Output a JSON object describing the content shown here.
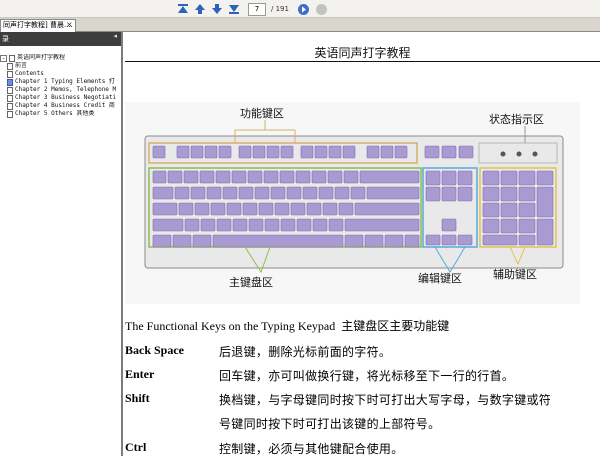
{
  "toolbar": {
    "page_current": "7",
    "page_total": "/ 191",
    "colors": {
      "nav_blue": "#2d63b8",
      "go_blue": "#3a6fd0",
      "disabled_grey": "#c2c2c2"
    }
  },
  "tab": {
    "label": "同声打字教程] 曹晨....",
    "close": "×"
  },
  "sidebar": {
    "header": "录",
    "collapse": "◂",
    "tree": [
      {
        "label": "英语同声打字教程",
        "kind": "root",
        "expander": "-"
      },
      {
        "label": "前言",
        "kind": "child"
      },
      {
        "label": "Contents",
        "kind": "child"
      },
      {
        "label": "Chapter 1  Typing Elements 打",
        "kind": "child"
      },
      {
        "label": "Chapter 2  Memos, Telephone M",
        "kind": "child"
      },
      {
        "label": "Chapter 3  Business Negotiati",
        "kind": "child"
      },
      {
        "label": "Chapter 4  Business Credit 商",
        "kind": "child"
      },
      {
        "label": "Chapter 5  Others 其他类",
        "kind": "child"
      }
    ]
  },
  "page": {
    "title": "英语同声打字教程",
    "callouts": {
      "function": "功能键区",
      "status": "状态指示区",
      "main": "主键盘区",
      "edit": "编辑键区",
      "numpad": "辅助键区"
    },
    "keyboard_colors": {
      "key": "#a99ad2",
      "key_dark": "#7c6cb0",
      "body": "#e9e9e9",
      "func_box": "#d7b06a",
      "main_box": "#8cc04a",
      "edit_box": "#57a9df",
      "num_box": "#e3c34c"
    },
    "intro_en": "The Functional Keys on the Typing Keypad",
    "intro_cn": "主键盘区主要功能键",
    "definitions": [
      {
        "term": "Back Space",
        "lines": [
          "后退键，删除光标前面的字符。"
        ]
      },
      {
        "term": "Enter",
        "lines": [
          "回车键，亦可叫做换行键，将光标移至下一行的行首。"
        ]
      },
      {
        "term": "Shift",
        "lines": [
          "换档键，与字母键同时按下时可打出大写字母，与数字键或符",
          "号键同时按下时可打出该键的上部符号。"
        ]
      },
      {
        "term": "Ctrl",
        "lines": [
          "控制键，必须与其他键配合使用。"
        ]
      }
    ]
  }
}
